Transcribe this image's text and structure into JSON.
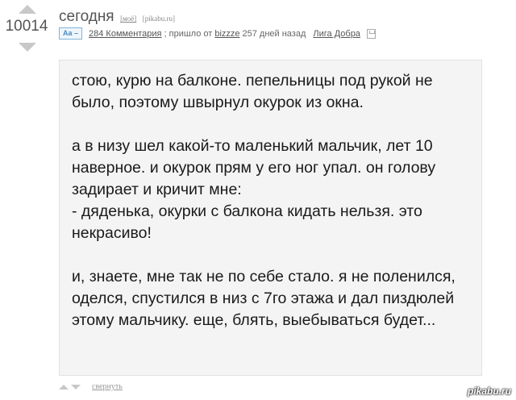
{
  "post": {
    "score": "10014",
    "title": "сегодня",
    "tags": [
      "[моё]",
      "[pikabu.ru]"
    ],
    "font_toggle": "Aa –",
    "comments": "284 Комментария",
    "came_from_text": "; пришло от",
    "author": "bizzze",
    "age": "257 дней назад",
    "community": "Лига Добра",
    "body": "стою, курю на балконе. пепельницы под рукой не было, поэтому швырнул окурок из окна.\n\nа в низу шел какой-то маленький мальчик, лет 10 наверное. и окурок прям у его ног упал. он голову задирает и кричит мне:\n- дяденька, окурки с балкона кидать нельзя. это некрасиво!\n\nи, знаете, мне так не по себе стало. я не поленился, оделся, спустился в низ с 7го этажа и дал пиздюлей этому мальчику. еще, блять, выебываться будет...",
    "collapse": "свернуть"
  },
  "watermark": "pikabu.ru",
  "icons": {
    "vote_up": "arrow-up-icon",
    "vote_down": "arrow-down-icon",
    "save": "save-icon"
  },
  "colors": {
    "post_bg": "#f4f4f4",
    "arrow": "#c8c8c8",
    "toggle_border": "#7fb4d8"
  }
}
